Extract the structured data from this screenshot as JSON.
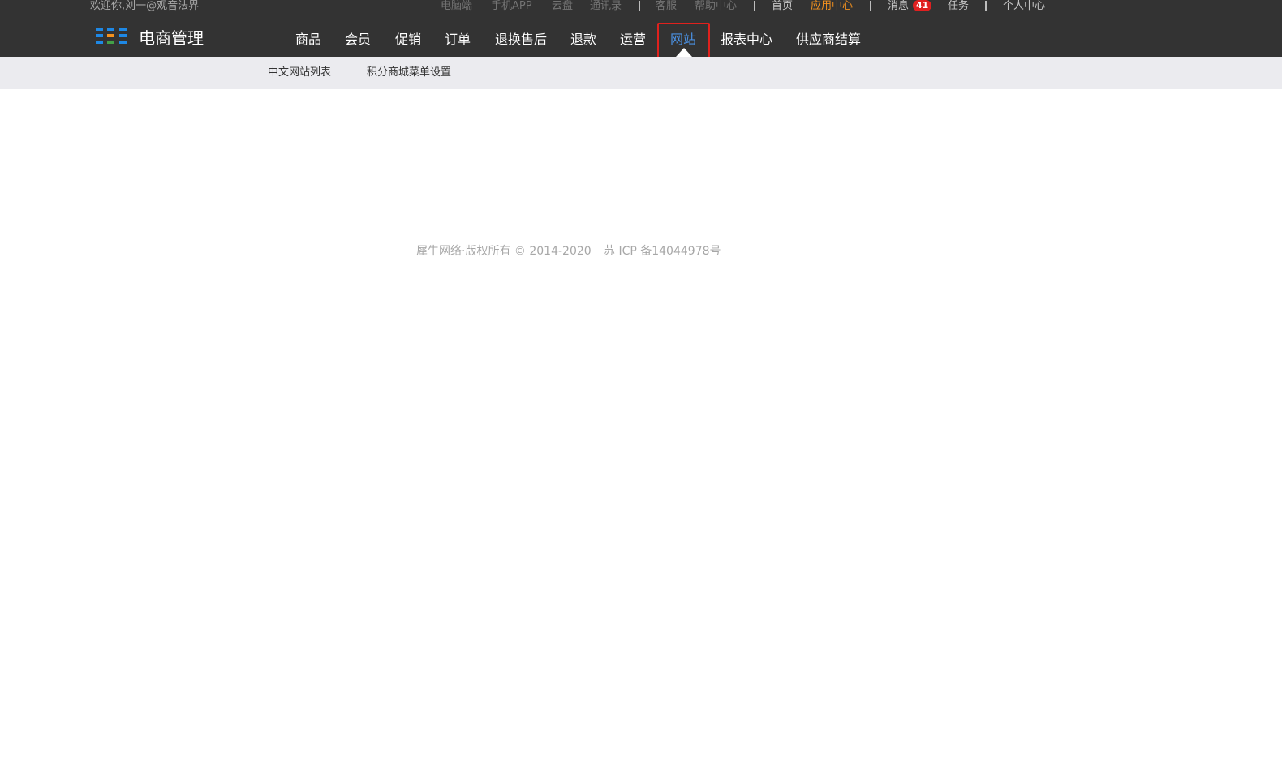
{
  "topbar": {
    "welcome": "欢迎你,刘一@观音法界",
    "links": {
      "pc": "电脑端",
      "app": "手机APP",
      "cloud": "云盘",
      "contacts": "通讯录",
      "service": "客服",
      "help": "帮助中心",
      "home": "首页",
      "app_center": "应用中心",
      "messages": "消息",
      "messages_count": "41",
      "tasks": "任务",
      "profile": "个人中心"
    }
  },
  "brand": {
    "title": "电商管理",
    "icon": "grid-icon"
  },
  "nav": {
    "active": "网站",
    "items": [
      "商品",
      "会员",
      "促销",
      "订单",
      "退换售后",
      "退款",
      "运营",
      "网站",
      "报表中心",
      "供应商结算"
    ]
  },
  "subnav": {
    "items": [
      "中文网站列表",
      "积分商城菜单设置"
    ]
  },
  "footer": {
    "copyright": "犀牛网络·版权所有 © 2014-2020",
    "icp": "苏 ICP 备14044978号"
  },
  "colors": {
    "topbar": "#333333",
    "accent": "#f5921e",
    "active_nav": "#4a90e2",
    "highlight": "#e0211d",
    "badge": "#e02020",
    "subnav_bg": "#ebebef"
  }
}
